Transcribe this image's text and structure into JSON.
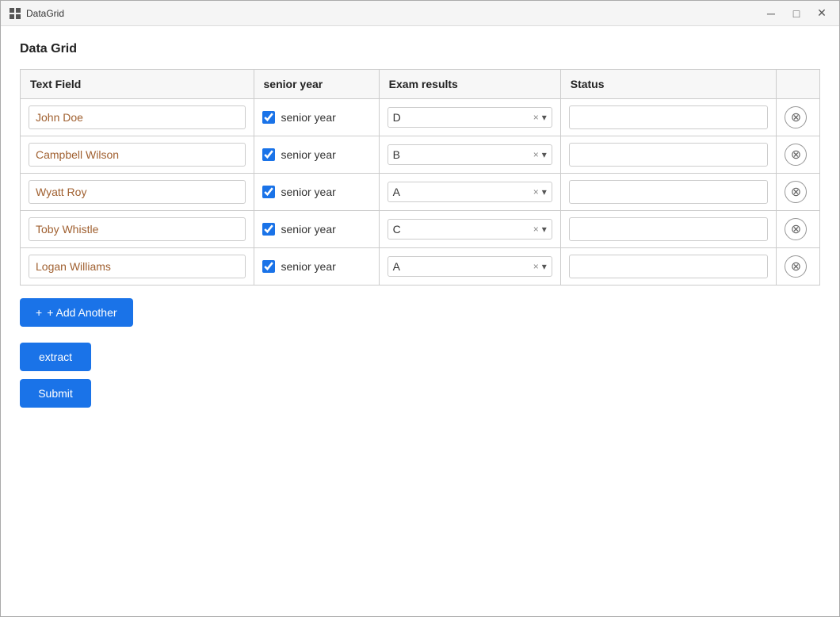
{
  "titleBar": {
    "appName": "DataGrid",
    "controls": {
      "minimize": "─",
      "maximize": "□",
      "close": "✕"
    }
  },
  "pageTitle": "Data Grid",
  "table": {
    "headers": {
      "textField": "Text Field",
      "seniorYear": "senior year",
      "examResults": "Exam results",
      "status": "Status"
    },
    "rows": [
      {
        "id": 1,
        "textField": "John Doe",
        "seniorYear": true,
        "seniorYearLabel": "senior year",
        "examResult": "D",
        "status": ""
      },
      {
        "id": 2,
        "textField": "Campbell Wilson",
        "seniorYear": true,
        "seniorYearLabel": "senior year",
        "examResult": "B",
        "status": ""
      },
      {
        "id": 3,
        "textField": "Wyatt Roy",
        "seniorYear": true,
        "seniorYearLabel": "senior year",
        "examResult": "A",
        "status": ""
      },
      {
        "id": 4,
        "textField": "Toby Whistle",
        "seniorYear": true,
        "seniorYearLabel": "senior year",
        "examResult": "C",
        "status": ""
      },
      {
        "id": 5,
        "textField": "Logan Williams",
        "seniorYear": true,
        "seniorYearLabel": "senior year",
        "examResult": "A",
        "status": ""
      }
    ]
  },
  "buttons": {
    "addAnother": "+ Add Another",
    "extract": "extract",
    "submit": "Submit"
  }
}
